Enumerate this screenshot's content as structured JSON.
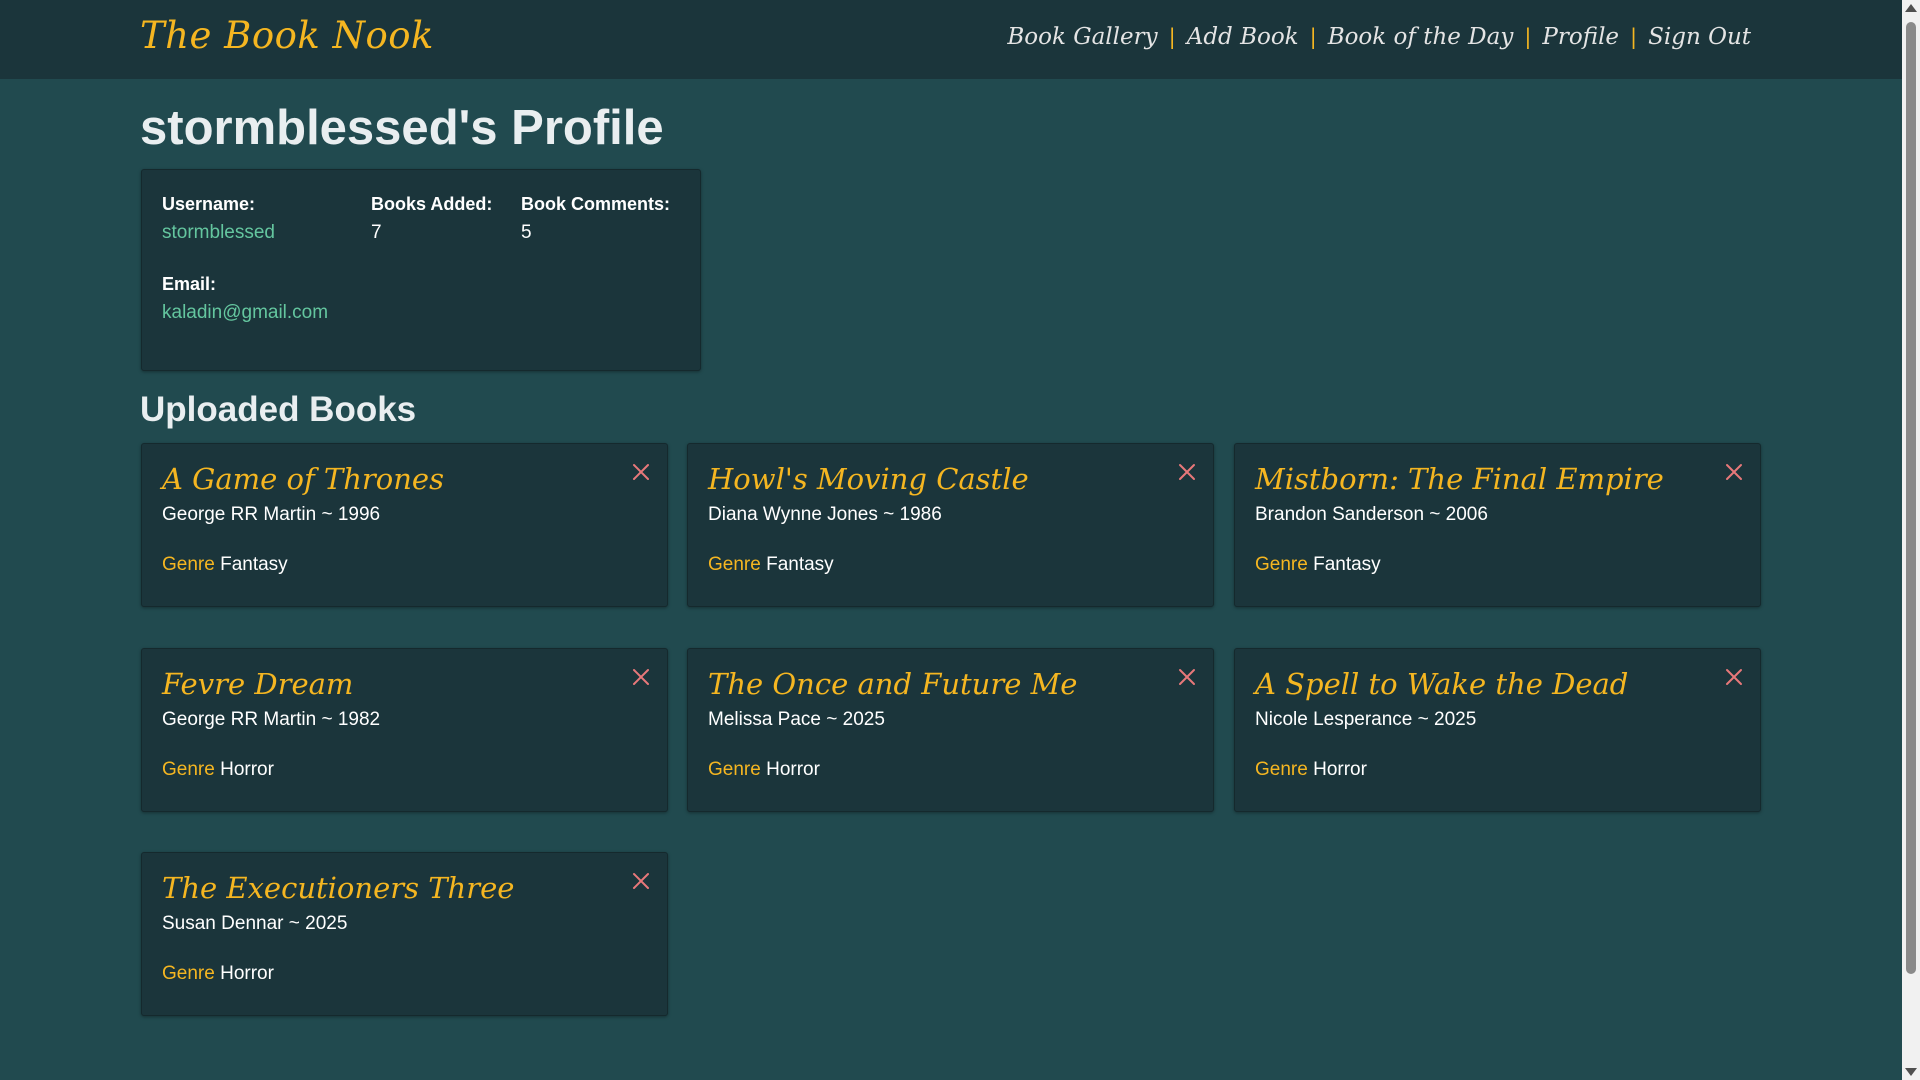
{
  "header": {
    "brand": "The Book Nook",
    "nav": [
      "Book Gallery",
      "Add Book",
      "Book of the Day",
      "Profile",
      "Sign Out"
    ],
    "separator": "|"
  },
  "page": {
    "title": "stormblessed's Profile"
  },
  "profile": {
    "username_label": "Username:",
    "username": "stormblessed",
    "books_added_label": "Books Added:",
    "books_added": "7",
    "comments_label": "Book Comments:",
    "comments": "5",
    "email_label": "Email:",
    "email": "kaladin@gmail.com"
  },
  "uploads": {
    "title": "Uploaded Books",
    "genre_label": "Genre",
    "books": [
      {
        "title": "A Game of Thrones",
        "meta": "George RR Martin ~ 1996",
        "genre": "Fantasy"
      },
      {
        "title": "Howl's Moving Castle",
        "meta": "Diana Wynne Jones ~ 1986",
        "genre": "Fantasy"
      },
      {
        "title": "Mistborn: The Final Empire",
        "meta": "Brandon Sanderson ~ 2006",
        "genre": "Fantasy"
      },
      {
        "title": "Fevre Dream",
        "meta": "George RR Martin ~ 1982",
        "genre": "Horror"
      },
      {
        "title": "The Once and Future Me",
        "meta": "Melissa Pace ~ 2025",
        "genre": "Horror"
      },
      {
        "title": "A Spell to Wake the Dead",
        "meta": "Nicole Lesperance ~ 2025",
        "genre": "Horror"
      },
      {
        "title": "The Executioners Three",
        "meta": "Susan Dennar ~ 2025",
        "genre": "Horror"
      }
    ]
  },
  "colors": {
    "background": "#214a4f",
    "card": "#1b353b",
    "accent": "#f5b621",
    "link": "#64c69f",
    "delete": "#e8787a"
  },
  "icons": {
    "delete": "close-icon"
  }
}
